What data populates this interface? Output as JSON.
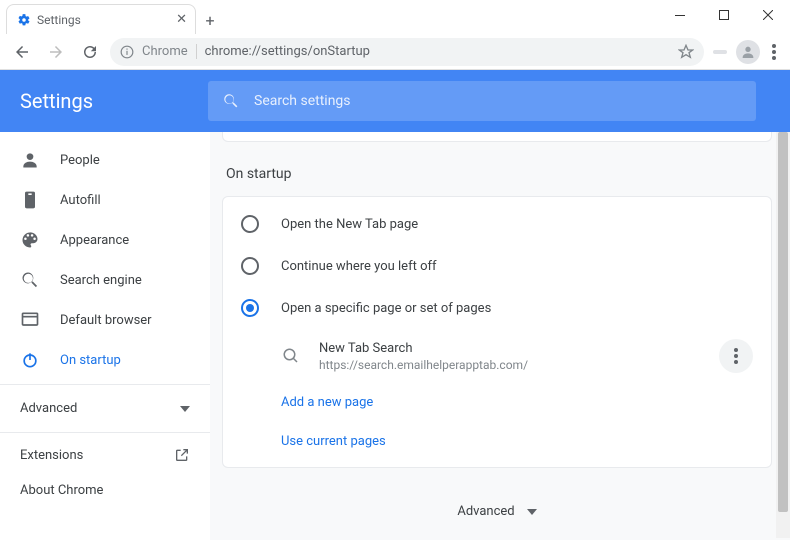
{
  "window": {
    "tab_title": "Settings",
    "chrome_label": "Chrome",
    "url": "chrome://settings/onStartup"
  },
  "header": {
    "title": "Settings",
    "search_placeholder": "Search settings"
  },
  "sidebar": {
    "items": [
      {
        "label": "People"
      },
      {
        "label": "Autofill"
      },
      {
        "label": "Appearance"
      },
      {
        "label": "Search engine"
      },
      {
        "label": "Default browser"
      },
      {
        "label": "On startup"
      }
    ],
    "advanced": "Advanced",
    "extensions": "Extensions",
    "about": "About Chrome"
  },
  "main": {
    "section_title": "On startup",
    "radio1": "Open the New Tab page",
    "radio2": "Continue where you left off",
    "radio3": "Open a specific page or set of pages",
    "page": {
      "name": "New Tab Search",
      "url": "https://search.emailhelperapptab.com/"
    },
    "add_link": "Add a new page",
    "use_current": "Use current pages",
    "advanced_footer": "Advanced"
  }
}
